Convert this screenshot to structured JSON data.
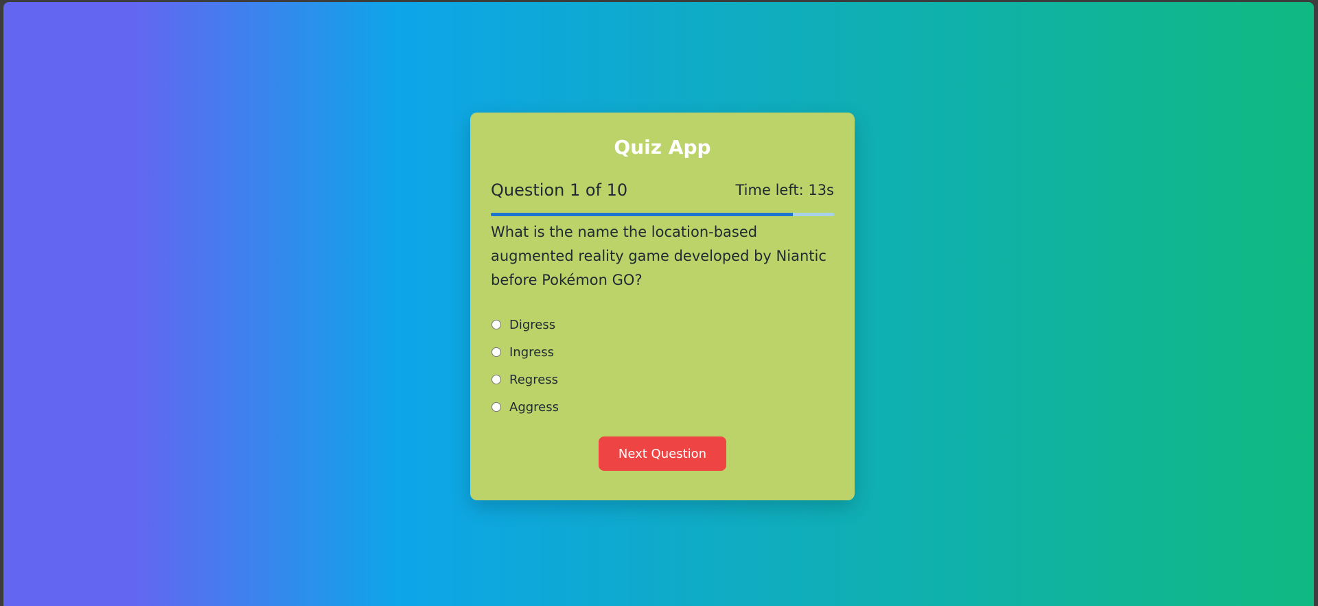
{
  "app": {
    "title": "Quiz App"
  },
  "quiz": {
    "counter": "Question 1 of 10",
    "timer": "Time left: 13s",
    "time_progress": 0.88,
    "question": "What is the name the location-based augmented reality game developed by Niantic before Pokémon GO?",
    "options": [
      "Digress",
      "Ingress",
      "Regress",
      "Aggress"
    ],
    "next_label": "Next Question"
  },
  "colors": {
    "background_gradient": [
      "#6366f1",
      "#0ea5e9",
      "#10b981"
    ],
    "card": "#bcd36a",
    "progress_fill": "#1f74d0",
    "progress_track": "#a8d0e8",
    "button": "#ef4444"
  }
}
